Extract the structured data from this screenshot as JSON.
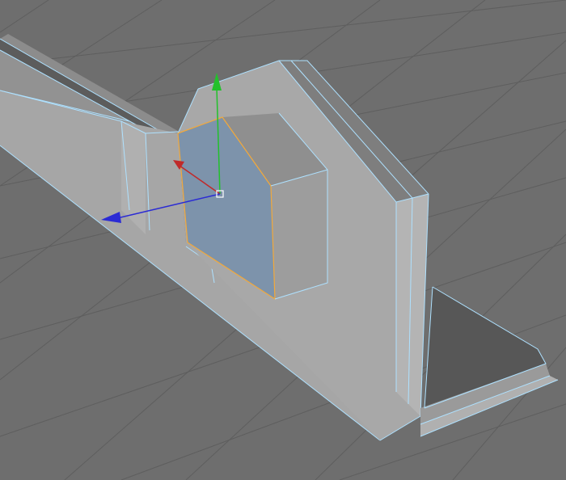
{
  "viewport": {
    "view": "perspective",
    "background_color": "#6e6e6e",
    "grid_color": "#5e5e5e",
    "wireframe_color": "#aee1ff"
  },
  "selection": {
    "mode": "polygon",
    "highlight_color": "#7d93ab",
    "edge_color": "#f2a93b"
  },
  "gizmo": {
    "type": "move",
    "axes": [
      {
        "axis": "y",
        "color": "#22c12b",
        "icon": "arrow-up-icon"
      },
      {
        "axis": "x",
        "color": "#c02a2a",
        "icon": "arrow-left-icon"
      },
      {
        "axis": "z",
        "color": "#2b2bd4",
        "icon": "arrow-left-icon"
      }
    ],
    "center_icon": "square-handle-icon"
  }
}
